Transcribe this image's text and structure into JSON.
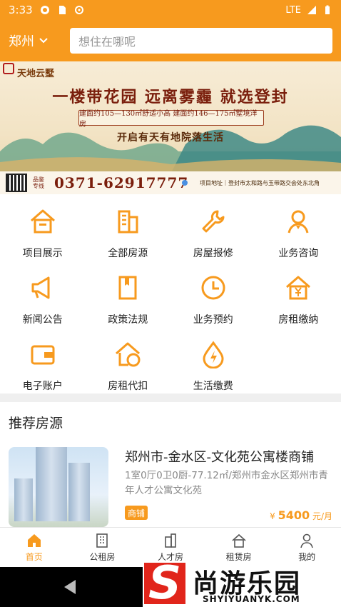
{
  "status_bar": {
    "time": "3:33",
    "network": "LTE"
  },
  "header": {
    "city": "郑州",
    "search_placeholder": "想住在哪呢"
  },
  "banner": {
    "brand": "天地云墅",
    "slogan": "一楼带花园 远离雾霾 就选登封",
    "box_text": "建面约105—130㎡舒适小高 建面约146—175㎡墅境洋房",
    "subtitle": "开启有天有地院落生活",
    "hotline_label": "品鉴专线",
    "phone": "0371-62917777",
    "address": "项目地址｜登封市太和路与玉带路交会处东北角"
  },
  "grid": [
    {
      "label": "项目展示",
      "icon": "house-icon"
    },
    {
      "label": "全部房源",
      "icon": "buildings-icon"
    },
    {
      "label": "房屋报修",
      "icon": "wrench-icon"
    },
    {
      "label": "业务咨询",
      "icon": "agent-icon"
    },
    {
      "label": "新闻公告",
      "icon": "megaphone-icon"
    },
    {
      "label": "政策法规",
      "icon": "book-icon"
    },
    {
      "label": "业务预约",
      "icon": "clock-icon"
    },
    {
      "label": "房租缴纳",
      "icon": "house-yen-icon"
    },
    {
      "label": "电子账户",
      "icon": "wallet-icon"
    },
    {
      "label": "房租代扣",
      "icon": "house-coin-icon"
    },
    {
      "label": "生活缴费",
      "icon": "bolt-drop-icon"
    }
  ],
  "section": {
    "title": "推荐房源"
  },
  "listing": {
    "title": "郑州市-金水区-文化苑公寓楼商铺",
    "desc": "1室0厅0卫0厨-77.12㎡/郑州市金水区郑州市青年人才公寓文化苑",
    "tag": "商铺",
    "price_prefix": "¥",
    "price": "5400",
    "price_unit": "元/月"
  },
  "tabs": [
    {
      "label": "首页",
      "icon": "home-icon",
      "active": true
    },
    {
      "label": "公租房",
      "icon": "building-icon",
      "active": false
    },
    {
      "label": "人才房",
      "icon": "tower-icon",
      "active": false
    },
    {
      "label": "租赁房",
      "icon": "rent-house-icon",
      "active": false
    },
    {
      "label": "我的",
      "icon": "user-icon",
      "active": false
    }
  ],
  "watermark": {
    "cn": "尚游乐园",
    "en": "SHYIYUANYK.COM",
    "logo_letter": "S"
  },
  "colors": {
    "accent": "#f79a1e",
    "text": "#222222",
    "muted": "#888888"
  }
}
